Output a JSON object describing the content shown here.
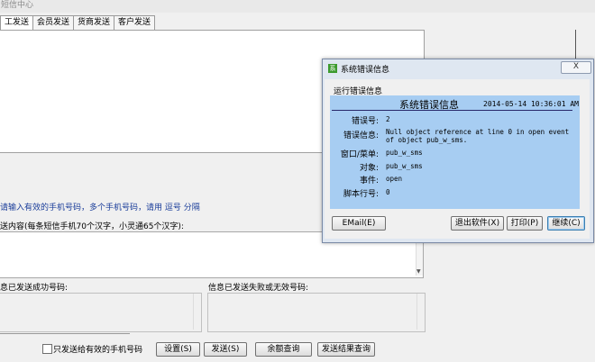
{
  "window": {
    "title": "短信中心"
  },
  "tabs": [
    {
      "label": "工发送"
    },
    {
      "label": "会员发送"
    },
    {
      "label": "货商发送"
    },
    {
      "label": "客户发送"
    }
  ],
  "hint": "请输入有效的手机号码，多个手机号码，请用 逗号 分隔",
  "content_label": "送内容(每条短信手机70个汉字，小灵通65个汉字):",
  "success_label": "息已发送成功号码:",
  "fail_label": "信息已发送失败或无效号码:",
  "bottom": {
    "checkbox_label": "只发送给有效的手机号码",
    "buttons": {
      "settings": "设置(S)",
      "send": "发送(S)",
      "balance": "余额查询",
      "result": "发送结果查询"
    }
  },
  "dialog": {
    "icon_text": "系",
    "title": "系统错误信息",
    "close": "X",
    "group_label": "运行错误信息",
    "panel_title": "系统错误信息",
    "timestamp": "2014-05-14 10:36:01 AM",
    "fields": [
      {
        "label": "错误号:",
        "value": "2"
      },
      {
        "label": "错误信息:",
        "value": "Null object reference at line 0 in open event of object pub_w_sms."
      },
      {
        "label": "窗口/菜单:",
        "value": "pub_w_sms"
      },
      {
        "label": "对象:",
        "value": "pub_w_sms"
      },
      {
        "label": "事件:",
        "value": "open"
      },
      {
        "label": "脚本行号:",
        "value": "0"
      }
    ],
    "buttons": {
      "email": "EMail(E)",
      "exit": "退出软件(X)",
      "print": "打印(P)",
      "continue": "继续(C)"
    }
  }
}
